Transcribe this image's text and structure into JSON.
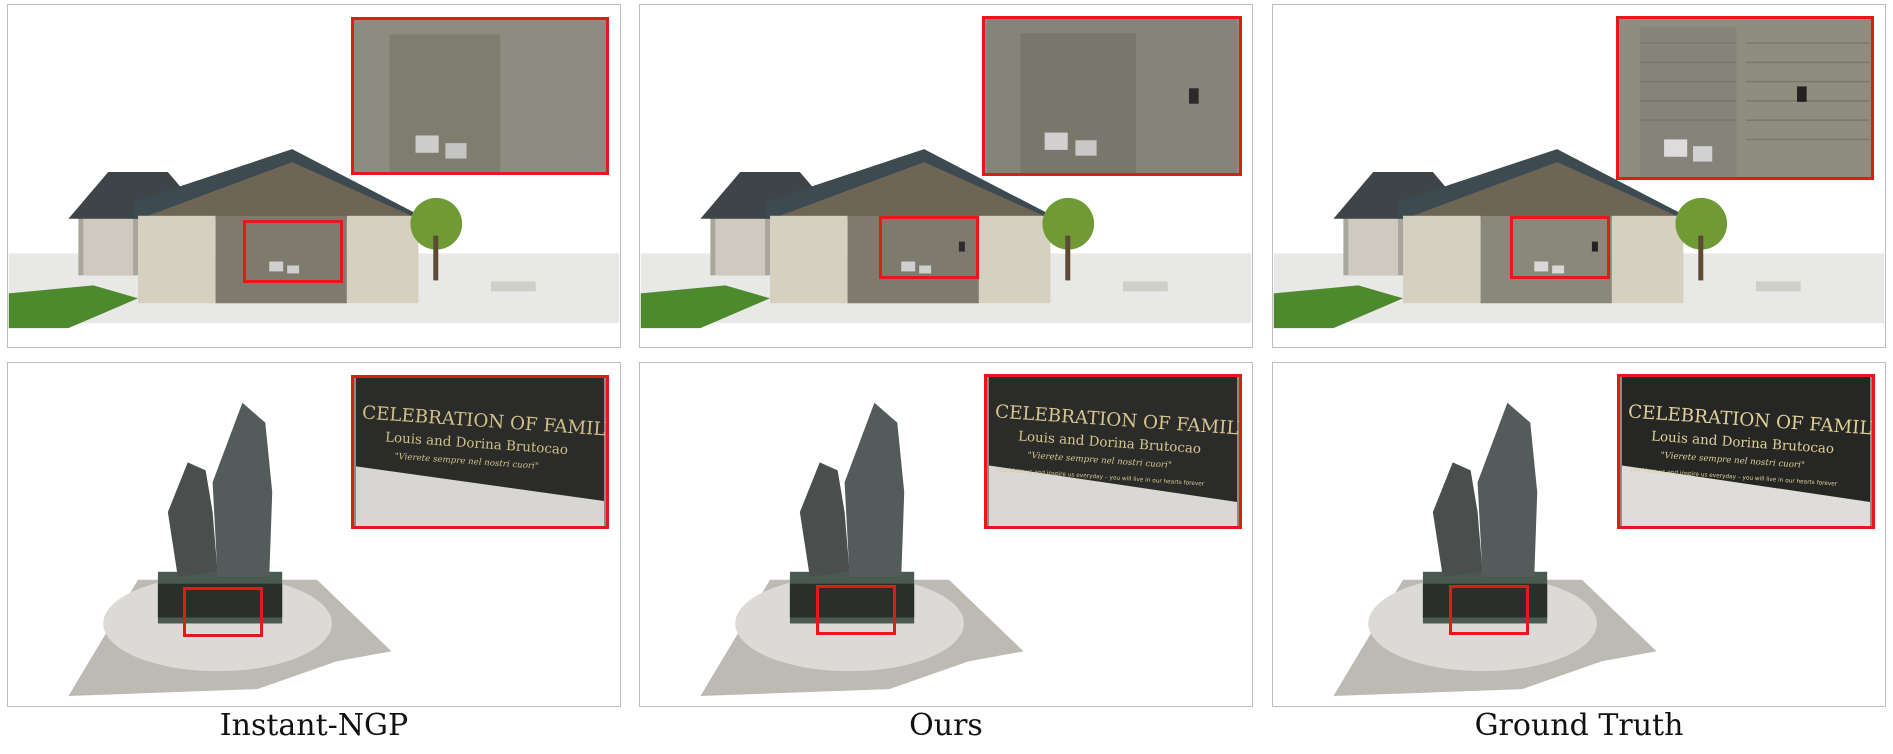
{
  "columns": [
    {
      "caption": "Instant-NGP"
    },
    {
      "caption": "Ours"
    },
    {
      "caption": "Ground Truth"
    }
  ],
  "plaque": {
    "title": "CELEBRATION OF FAMILY",
    "names": "Louis and Dorina Brutocao",
    "motto": "\"Vierete sempre nel nostri cuori\"",
    "line": "you bless us and inspire us everyday – you will live in our hearts forever"
  }
}
